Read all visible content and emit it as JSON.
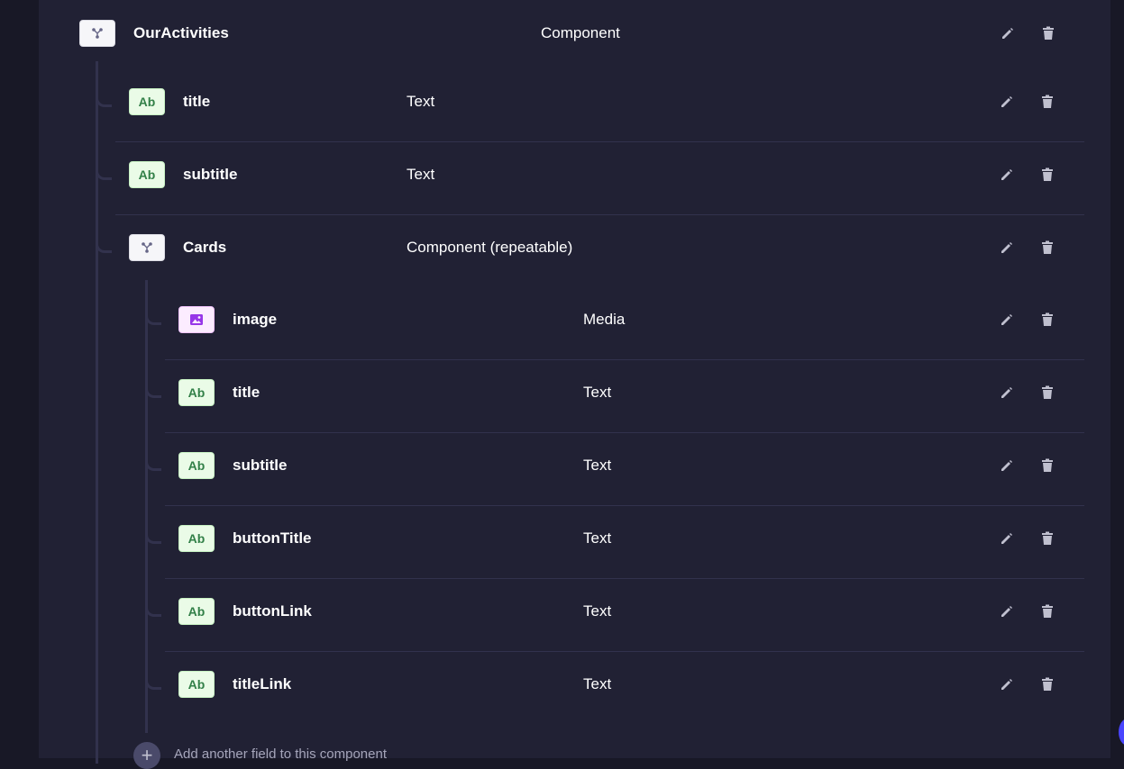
{
  "root": {
    "name": "OurActivities",
    "type": "Component",
    "icon": "component-icon"
  },
  "level1_fields": [
    {
      "name": "title",
      "type": "Text",
      "badge": "Ab"
    },
    {
      "name": "subtitle",
      "type": "Text",
      "badge": "Ab"
    },
    {
      "name": "Cards",
      "type": "Component (repeatable)",
      "icon": "component-icon"
    }
  ],
  "cards_fields": [
    {
      "name": "image",
      "type": "Media",
      "icon": "image-icon"
    },
    {
      "name": "title",
      "type": "Text",
      "badge": "Ab"
    },
    {
      "name": "subtitle",
      "type": "Text",
      "badge": "Ab"
    },
    {
      "name": "buttonTitle",
      "type": "Text",
      "badge": "Ab"
    },
    {
      "name": "buttonLink",
      "type": "Text",
      "badge": "Ab"
    },
    {
      "name": "titleLink",
      "type": "Text",
      "badge": "Ab"
    }
  ],
  "add_field_label": "Add another field to this component",
  "colors": {
    "background": "#181826",
    "panel": "#212134",
    "text_badge_bg": "#eafbe7",
    "text_badge_fg": "#328048",
    "media_badge_bg": "#fcecff",
    "media_icon": "#9736e8",
    "accent": "#4945ff"
  }
}
